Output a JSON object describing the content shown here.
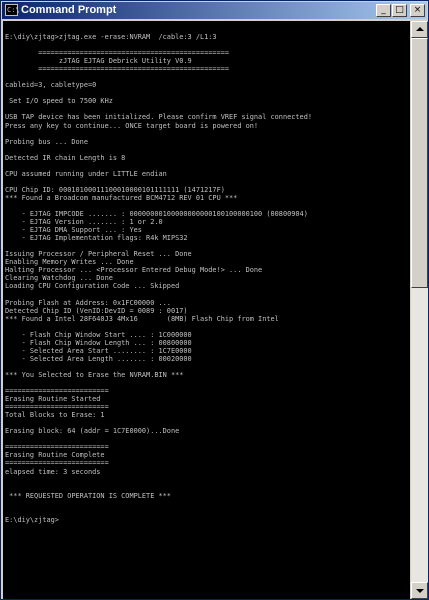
{
  "window": {
    "title": "Command Prompt",
    "icon_name": "console-app-icon",
    "buttons": {
      "minimize": "_",
      "maximize": "□",
      "close": "×"
    }
  },
  "console": {
    "background": "#000000",
    "foreground": "#c0c0c0",
    "lines": [
      "E:\\diy\\zjtag>zjtag.exe -erase:NVRAM  /cable:3 /L1:3",
      "",
      "        ==============================================",
      "             zJTAG EJTAG Debrick Utility V0.9",
      "        ==============================================",
      "",
      "cableid=3, cabletype=0",
      "",
      " Set I/O speed to 7500 KHz",
      "",
      "USB TAP device has been initialized. Please confirm VREF signal connected!",
      "Press any key to continue... ONCE target board is powered on!",
      "",
      "Probing bus ... Done",
      "",
      "Detected IR chain Length is 8",
      "",
      "CPU assumed running under LITTLE endian",
      "",
      "CPU Chip ID: 00010100011100010000101111111 (1471217F)",
      "*** Found a Broadcom manufactured BCM4712 REV 01 CPU ***",
      "",
      "    - EJTAG IMPCODE ....... : 00000000100000000000100100000100 (00800904)",
      "    - EJTAG Version ....... : 1 or 2.0",
      "    - EJTAG DMA Support ... : Yes",
      "    - EJTAG Implementation flags: R4k MIPS32",
      "",
      "Issuing Processor / Peripheral Reset ... Done",
      "Enabling Memory Writes ... Done",
      "Halting Processor ... <Processor Entered Debug Mode!> ... Done",
      "Clearing Watchdog ... Done",
      "Loading CPU Configuration Code ... Skipped",
      "",
      "Probing Flash at Address: 0x1FC00000 ...",
      "Detected Chip ID (VenID:DevID = 0089 : 0017)",
      "*** Found a Intel 28F640J3 4Mx16       (8MB) Flash Chip from Intel",
      "",
      "    - Flash Chip Window Start .... : 1C000000",
      "    - Flash Chip Window Length ... : 00800000",
      "    - Selected Area Start ........ : 1C7E0000",
      "    - Selected Area Length ....... : 00020000",
      "",
      "*** You Selected to Erase the NVRAM.BIN ***",
      "",
      "=========================",
      "Erasing Routine Started",
      "=========================",
      "Total Blocks to Erase: 1",
      "",
      "Erasing block: 64 (addr = 1C7E0000)...Done",
      "",
      "=========================",
      "Erasing Routine Complete",
      "=========================",
      "elapsed time: 3 seconds",
      "",
      "",
      " *** REQUESTED OPERATION IS COMPLETE ***",
      "",
      "",
      "E:\\diy\\zjtag>"
    ]
  },
  "scrollbar": {
    "position": 0,
    "up_icon": "arrow-up-icon",
    "down_icon": "arrow-down-icon"
  }
}
